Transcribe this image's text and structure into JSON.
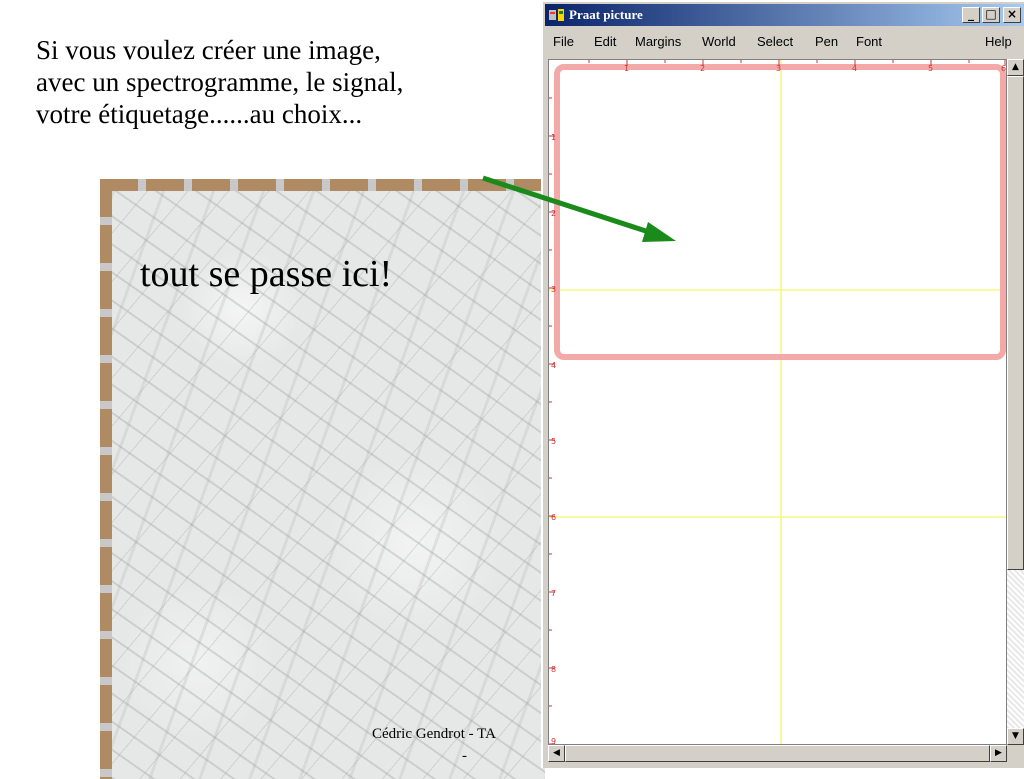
{
  "slide": {
    "intro_lines": [
      "Si vous voulez créer une image,",
      "avec un spectrogramme, le signal,",
      "votre étiquetage......au choix..."
    ],
    "caption": "tout se passe ici!",
    "footer": "Cédric Gendrot  -  TA",
    "footer_dash": "-"
  },
  "colors": {
    "arrow": "#1a8a1a",
    "selection": "#f4a9a9",
    "guide_lines": "#f5f56a",
    "ruler": "#cc3333",
    "title_bar": "#0a246a"
  },
  "praat": {
    "title": "Praat picture",
    "window_buttons": {
      "minimize": "_",
      "maximize": "□",
      "close": "×"
    },
    "menus": [
      "File",
      "Edit",
      "Margins",
      "World",
      "Select",
      "Pen",
      "Font",
      "Help"
    ],
    "top_ruler": [
      "1",
      "2",
      "3",
      "4",
      "5",
      "6"
    ],
    "left_ruler": [
      "1",
      "2",
      "3",
      "4",
      "5",
      "6",
      "7",
      "8",
      "9"
    ],
    "scroll_icons": {
      "up": "▲",
      "down": "▼",
      "left": "◀",
      "right": "▶"
    }
  }
}
